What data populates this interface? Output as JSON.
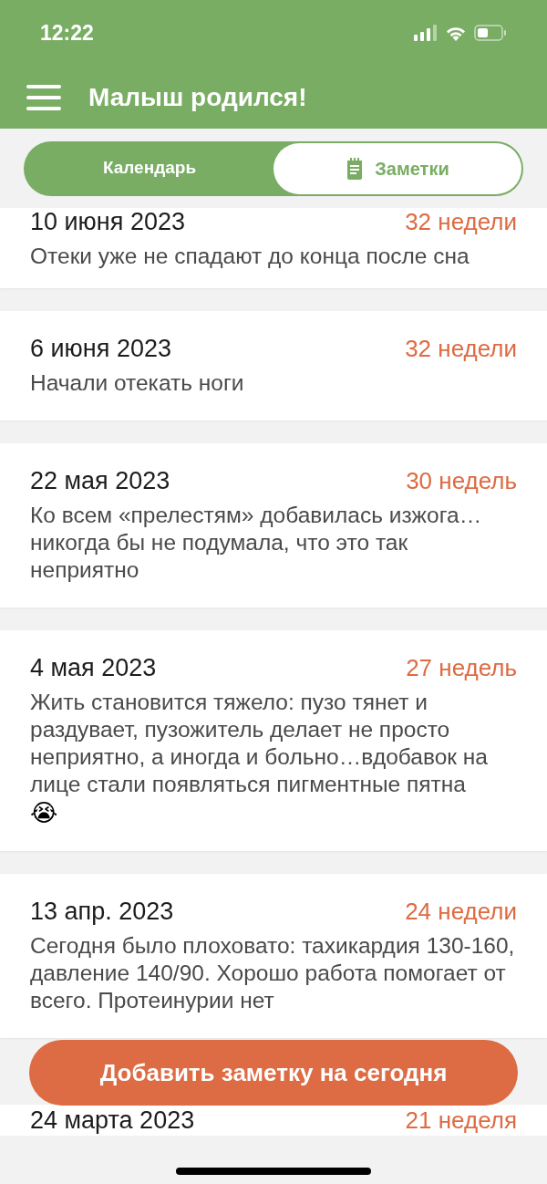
{
  "status_bar": {
    "time": "12:22"
  },
  "header": {
    "title": "Малыш родился!"
  },
  "tabs": [
    {
      "label": "Календарь",
      "selected": false,
      "icon": false
    },
    {
      "label": "Заметки",
      "selected": true,
      "icon": true
    }
  ],
  "notes": [
    {
      "date": "10 июня 2023",
      "weeks": "32 недели",
      "text": "Отеки уже не спадают до конца после сна"
    },
    {
      "date": "6 июня 2023",
      "weeks": "32 недели",
      "text": "Начали отекать ноги"
    },
    {
      "date": "22 мая 2023",
      "weeks": "30 недель",
      "text": "Ко всем «прелестям» добавилась изжога… никогда бы не подумала, что это так неприятно"
    },
    {
      "date": "4 мая 2023",
      "weeks": "27 недель",
      "text": "Жить становится тяжело: пузо тянет и раздувает, пузожитель делает не просто неприятно, а иногда и больно…вдобавок на лице стали появляться пигментные пятна",
      "emoji": "😭"
    },
    {
      "date": "13 апр. 2023",
      "weeks": "24 недели",
      "text": "Сегодня было плоховато: тахикардия 130-160, давление 140/90. Хорошо работа помогает от всего. Протеинурии нет"
    },
    {
      "date": "24 марта 2023",
      "weeks": "21 неделя"
    }
  ],
  "add_button": {
    "label": "Добавить заметку на сегодня"
  }
}
